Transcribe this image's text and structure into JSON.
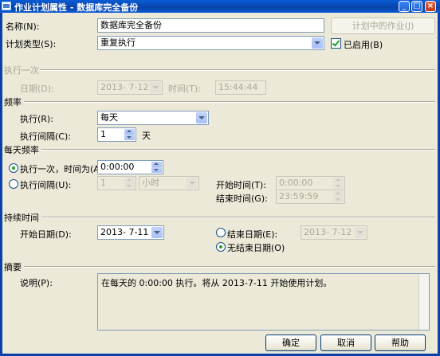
{
  "window": {
    "title": "作业计划属性 - 数据库完全备份"
  },
  "name": {
    "label": "名称(N):",
    "value": "数据库完全备份"
  },
  "jobs_button": "计划中的作业(J)",
  "schedule_type": {
    "label": "计划类型(S):",
    "value": "重复执行"
  },
  "enabled": {
    "label": "已启用(B)",
    "checked": true
  },
  "once": {
    "section": "执行一次",
    "date_label": "日期(D):",
    "date_value": "2013- 7-12",
    "time_label": "时间(T):",
    "time_value": "15:44:44"
  },
  "frequency": {
    "section": "频率",
    "occurs_label": "执行(R):",
    "occurs_value": "每天",
    "interval_label": "执行间隔(C):",
    "interval_value": "1",
    "interval_unit": "天"
  },
  "daily": {
    "section": "每天频率",
    "once_at_label": "执行一次，时间为(A):",
    "once_at_value": "0:00:00",
    "every_label": "执行间隔(U):",
    "every_value": "1",
    "every_unit": "小时",
    "start_label": "开始时间(T):",
    "start_value": "0:00:00",
    "end_label": "结束时间(G):",
    "end_value": "23:59:59"
  },
  "duration": {
    "section": "持续时间",
    "start_date_label": "开始日期(D):",
    "start_date_value": "2013- 7-11",
    "end_date_label": "结束日期(E):",
    "end_date_value": "2013- 7-12",
    "no_end_label": "无结束日期(O)"
  },
  "summary": {
    "section": "摘要",
    "desc_label": "说明(P):",
    "desc_value": "在每天的 0:00:00 执行。将从 2013-7-11 开始使用计划。"
  },
  "buttons": {
    "ok": "确定",
    "cancel": "取消",
    "help": "帮助"
  },
  "colors": {
    "titlebar": "#0a5bd5",
    "dialog_bg": "#ece9d8",
    "check_green": "#21a121"
  }
}
